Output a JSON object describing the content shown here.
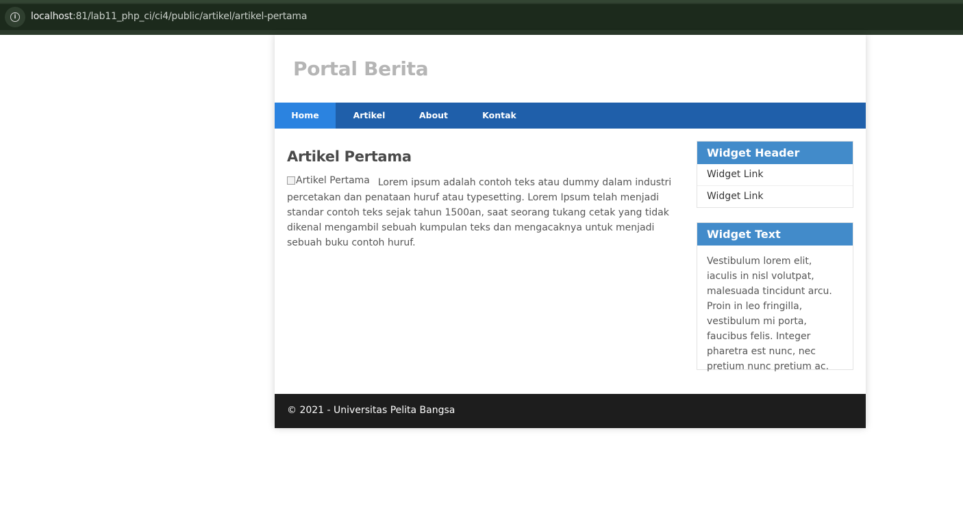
{
  "browser": {
    "url_host": "localhost",
    "url_path": ":81/lab11_php_ci/ci4/public/artikel/artikel-pertama",
    "info_icon": "info-icon"
  },
  "site": {
    "title": "Portal Berita"
  },
  "nav": {
    "items": [
      {
        "label": "Home",
        "active": true
      },
      {
        "label": "Artikel",
        "active": false
      },
      {
        "label": "About",
        "active": false
      },
      {
        "label": "Kontak",
        "active": false
      }
    ]
  },
  "article": {
    "title": "Artikel Pertama",
    "image_alt": "Artikel Pertama",
    "body": "Lorem ipsum adalah contoh teks atau dummy dalam industri percetakan dan penataan huruf atau typesetting. Lorem Ipsum telah menjadi standar contoh teks sejak tahun 1500an, saat seorang tukang cetak yang tidak dikenal mengambil sebuah kumpulan teks dan mengacaknya untuk menjadi sebuah buku contoh huruf."
  },
  "sidebar": {
    "widget1": {
      "header": "Widget Header",
      "links": [
        "Widget Link",
        "Widget Link"
      ]
    },
    "widget2": {
      "header": "Widget Text",
      "text": "Vestibulum lorem elit, iaculis in nisl volutpat, malesuada tincidunt arcu. Proin in leo fringilla, vestibulum mi porta, faucibus felis. Integer pharetra est nunc, nec pretium nunc pretium ac."
    }
  },
  "footer": {
    "text": "© 2021 - Universitas Pelita Bangsa"
  },
  "colors": {
    "nav_bg": "#1f5faa",
    "nav_active": "#2b83e0",
    "widget_header": "#428bca",
    "footer_bg": "#1d1d1d"
  }
}
